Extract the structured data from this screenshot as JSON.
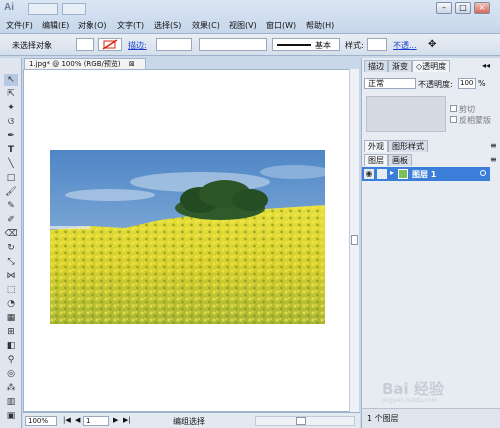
{
  "app": {
    "logo": "Ai"
  },
  "menu": [
    "文件(F)",
    "编辑(E)",
    "对象(O)",
    "文字(T)",
    "选择(S)",
    "效果(C)",
    "视图(V)",
    "窗口(W)",
    "帮助(H)"
  ],
  "window_controls": [
    "–",
    "□",
    "×"
  ],
  "control_bar": {
    "selection": "未选择对象",
    "stroke_label": "描边:",
    "stroke_style": "基本",
    "style_label": "样式:",
    "opacity_link": "不透..."
  },
  "document": {
    "tab_title": "1.jpg* @ 100% (RGB/预览)",
    "close": "⊠"
  },
  "status": {
    "zoom": "100%",
    "page": "1",
    "mode": "编组选择"
  },
  "panel_top": {
    "tabs": [
      "描边",
      "渐变",
      "◇透明度"
    ],
    "blend_mode": "正常",
    "opacity_label": "不透明度:",
    "opacity_value": "100",
    "opacity_unit": "%",
    "options": [
      "剪切",
      "反相蒙版"
    ]
  },
  "panel_mid": {
    "tabs": [
      "外观",
      "图形样式"
    ]
  },
  "panel_layers": {
    "tabs": [
      "图层",
      "画板"
    ],
    "layer_name": "图层 1",
    "footer": "1 个图层"
  },
  "watermark": {
    "text": "Bai 经验",
    "sub": "jingyan.baidu.com"
  },
  "colors": {
    "chrome": "#c9d7e8",
    "selection": "#3b7ed9",
    "link": "#1a3fd0"
  }
}
